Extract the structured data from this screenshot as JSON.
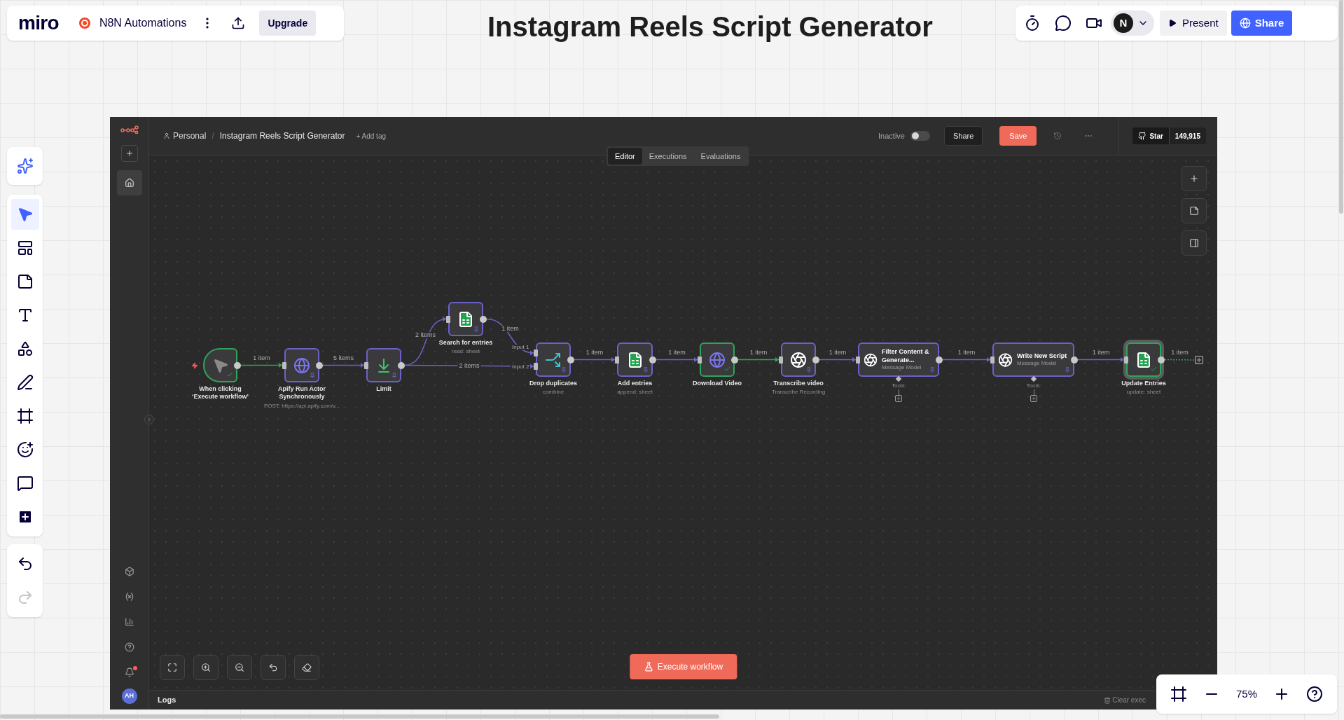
{
  "board_bar": {
    "logo": "miro",
    "board_name": "N8N Automations",
    "upgrade": "Upgrade"
  },
  "board_title": "Instagram Reels Script Generator",
  "collab_bar": {
    "avatar": "N",
    "present": "Present",
    "share": "Share"
  },
  "tools": [
    {
      "selected": true
    },
    {
      "selected": false
    },
    {
      "selected": false
    },
    {
      "selected": false
    },
    {
      "selected": false
    },
    {
      "selected": false
    },
    {
      "selected": false
    },
    {
      "selected": false
    },
    {
      "selected": false
    },
    {
      "selected": false
    }
  ],
  "history": [
    {
      "disabled": false
    },
    {
      "disabled": true
    }
  ],
  "n8n": {
    "owner": "Personal",
    "separator": "/",
    "workflow_name": "Instagram Reels Script Generator",
    "add_tag": "+ Add tag",
    "status_label": "Inactive",
    "active": false,
    "share": "Share",
    "save": "Save",
    "star": "Star",
    "star_count": "149,915",
    "avatar": "AH",
    "notifications_unread": true,
    "tabs": [
      {
        "label": "Editor",
        "selected": true
      },
      {
        "label": "Executions",
        "selected": false
      },
      {
        "label": "Evaluations",
        "selected": false
      }
    ],
    "nodes": [
      {
        "kind": "trigger",
        "title": "When clicking ‘Execute workflow’",
        "executed": true,
        "pinned": false,
        "selected": false
      },
      {
        "kind": "action",
        "title": "Apify Run Actor Synchronously",
        "subtitle": "POST: https://api.apify.com/v...",
        "executed": false,
        "pinned": true,
        "selected": false
      },
      {
        "kind": "action",
        "title": "Limit",
        "executed": false,
        "pinned": true,
        "selected": false
      },
      {
        "kind": "action",
        "title": "Search for entries",
        "subtitle": "read: sheet",
        "executed": false,
        "pinned": true,
        "selected": false
      },
      {
        "kind": "action",
        "title": "Drop duplicates",
        "subtitle": "combine",
        "inputs": [
          "Input 1",
          "Input 2"
        ],
        "executed": false,
        "pinned": true,
        "selected": false
      },
      {
        "kind": "action",
        "title": "Add entries",
        "subtitle": "append: sheet",
        "executed": false,
        "pinned": true,
        "selected": false
      },
      {
        "kind": "action",
        "title": "Download Video",
        "executed": true,
        "pinned": false,
        "selected": false
      },
      {
        "kind": "action",
        "title": "Transcribe video",
        "subtitle": "Transcribe Recording",
        "executed": false,
        "pinned": true,
        "selected": false
      },
      {
        "kind": "agent",
        "title": "Filter Content & Generate...",
        "subtitle": "Message Model",
        "tools_label": "Tools",
        "executed": false,
        "pinned": true,
        "selected": false
      },
      {
        "kind": "agent",
        "title": "Write New Script",
        "subtitle": "Message Model",
        "tools_label": "Tools",
        "executed": false,
        "pinned": true,
        "selected": false
      },
      {
        "kind": "action",
        "title": "Update Entries",
        "subtitle": "update: sheet",
        "executed": true,
        "pinned": false,
        "selected": true
      }
    ],
    "edges": [
      {
        "label": "1 item",
        "executed": true
      },
      {
        "label": "5 items",
        "executed": false
      },
      {
        "label": "2 items",
        "executed": false
      },
      {
        "label": "1 item",
        "executed": false
      },
      {
        "label": "2 items",
        "executed": false
      },
      {
        "label": "1 item",
        "executed": false
      },
      {
        "label": "1 item",
        "executed": false
      },
      {
        "label": "1 item",
        "executed": true
      },
      {
        "label": "1 item",
        "executed": false
      },
      {
        "label": "1 item",
        "executed": false
      },
      {
        "label": "1 item",
        "executed": false
      },
      {
        "label": "1 item",
        "executed": true
      }
    ],
    "execute": "Execute workflow",
    "logs": "Logs",
    "clear": "Clear exec"
  },
  "zoom": {
    "value": "75%"
  }
}
